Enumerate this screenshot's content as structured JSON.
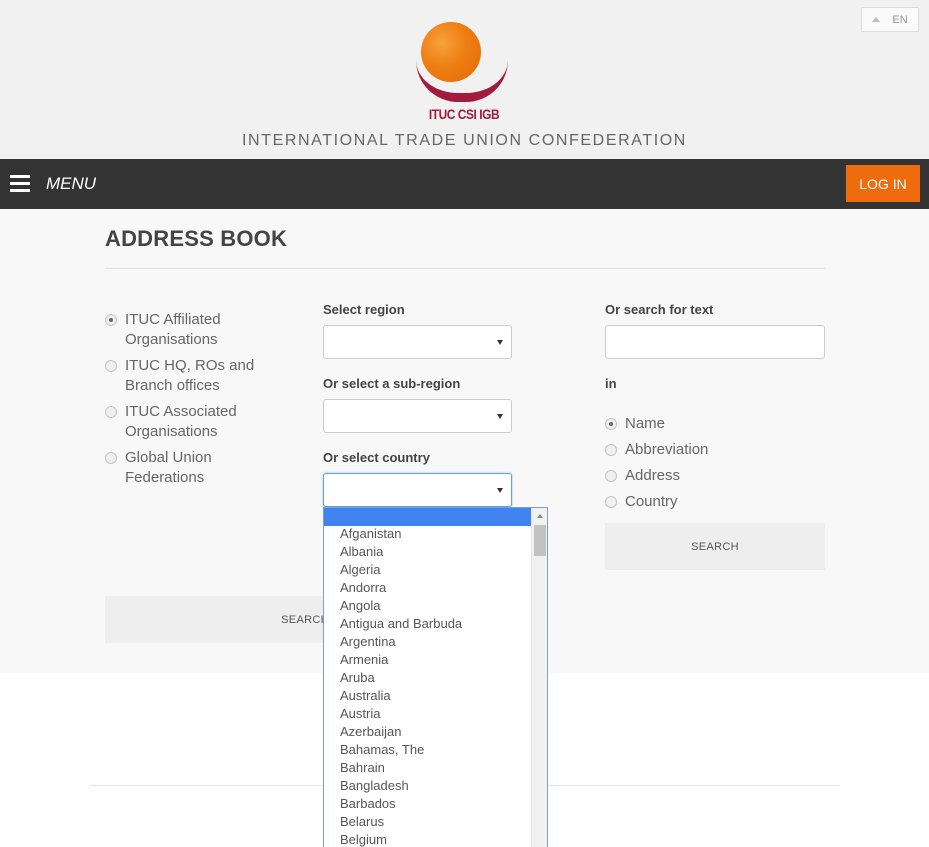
{
  "header": {
    "lang_label": "EN",
    "logo_text": "ITUC CSI IGB",
    "org_name": "INTERNATIONAL TRADE UNION CONFEDERATION"
  },
  "nav": {
    "menu_label": "MENU",
    "login_label": "LOG IN"
  },
  "page": {
    "title": "ADDRESS BOOK"
  },
  "org_types": [
    {
      "label": "ITUC Affiliated Organisations",
      "checked": true
    },
    {
      "label": "ITUC HQ, ROs and Branch offices",
      "checked": false
    },
    {
      "label": "ITUC Associated Organisations",
      "checked": false
    },
    {
      "label": "Global Union Federations",
      "checked": false
    }
  ],
  "filters": {
    "region_label": "Select region",
    "region_value": "",
    "subregion_label": "Or select a sub-region",
    "subregion_value": "",
    "country_label": "Or select country",
    "country_value": ""
  },
  "text_search": {
    "label": "Or search for text",
    "value": "",
    "in_label": "in",
    "fields": [
      {
        "label": "Name",
        "checked": true
      },
      {
        "label": "Abbreviation",
        "checked": false
      },
      {
        "label": "Address",
        "checked": false
      },
      {
        "label": "Country",
        "checked": false
      }
    ],
    "search_label": "SEARCH"
  },
  "left_search_label": "SEARCH",
  "country_options": [
    "",
    "Afganistan",
    "Albania",
    "Algeria",
    "Andorra",
    "Angola",
    "Antigua and Barbuda",
    "Argentina",
    "Armenia",
    "Aruba",
    "Australia",
    "Austria",
    "Azerbaijan",
    "Bahamas, The",
    "Bahrain",
    "Bangladesh",
    "Barbados",
    "Belarus",
    "Belgium"
  ],
  "colors": {
    "accent_orange": "#ef6c0e",
    "nav_bg": "#333333",
    "logo_red": "#a21a3c",
    "highlight_blue": "#3f84f1"
  }
}
